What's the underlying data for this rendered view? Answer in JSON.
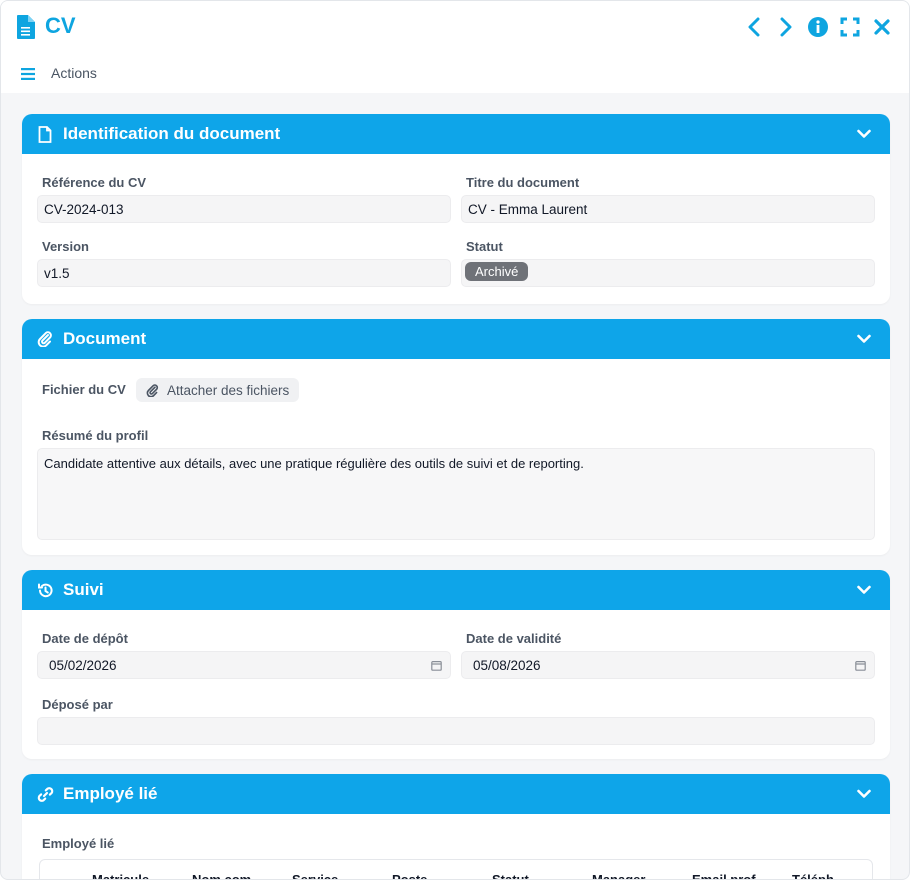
{
  "window": {
    "title": "CV",
    "controls": [
      "chevron-left-icon",
      "chevron-right-icon",
      "info-icon",
      "fullscreen-icon",
      "close-icon"
    ]
  },
  "actions_bar": {
    "label": "Actions"
  },
  "accent_color": "#0ea5e9",
  "sections": {
    "identification": {
      "title": "Identification du document",
      "fields": {
        "reference_label": "Référence du CV",
        "reference_value": "CV-2024-013",
        "title_label": "Titre du document",
        "title_value": "CV - Emma Laurent",
        "version_label": "Version",
        "version_value": "v1.5",
        "status_label": "Statut",
        "status_value": "Archivé"
      }
    },
    "document": {
      "title": "Document",
      "file_label": "Fichier du CV",
      "attach_button": "Attacher des fichiers",
      "summary_label": "Résumé du profil",
      "summary_value": "Candidate attentive aux détails, avec une pratique régulière des outils de suivi et de reporting."
    },
    "suivi": {
      "title": "Suivi",
      "deposit_date_label": "Date de dépôt",
      "deposit_date_value": "05/02/2026",
      "validity_date_label": "Date de validité",
      "validity_date_value": "05/08/2026",
      "deposited_by_label": "Déposé par",
      "deposited_by_value": ""
    },
    "employee": {
      "title": "Employé lié",
      "field_label": "Employé lié",
      "columns": [
        "Matricule",
        "Nom com",
        "Service",
        "Poste",
        "Statut",
        "Manager",
        "Email prof",
        "Téléph"
      ]
    }
  }
}
